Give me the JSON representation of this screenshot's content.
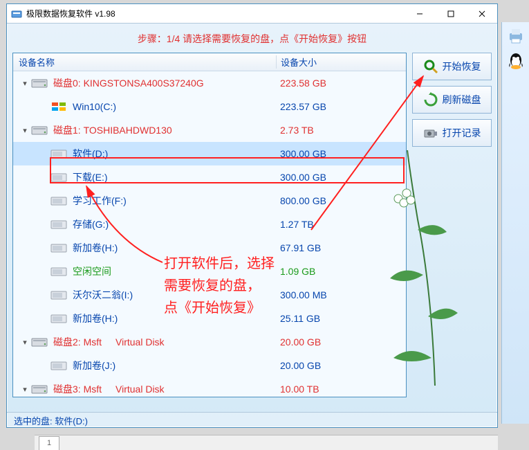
{
  "window_title": "极限数据恢复软件 v1.98",
  "step_banner": "步骤：1/4 请选择需要恢复的盘，点《开始恢复》按钮",
  "columns": {
    "name": "设备名称",
    "size": "设备大小"
  },
  "rows": [
    {
      "exp": "▾",
      "indent": 0,
      "label": "磁盘0: KINGSTONSA400S37240G",
      "size": "223.58 GB",
      "color": "red",
      "icon": "hdd"
    },
    {
      "exp": "",
      "indent": 1,
      "label": "Win10(C:)",
      "size": "223.57 GB",
      "color": "blue",
      "icon": "winvol"
    },
    {
      "exp": "▾",
      "indent": 0,
      "label": "磁盘1: TOSHIBAHDWD130",
      "size": "2.73 TB",
      "color": "red",
      "icon": "hdd"
    },
    {
      "exp": "",
      "indent": 1,
      "label": "软件(D:)",
      "size": "300.00 GB",
      "color": "blue",
      "icon": "vol",
      "selected": true
    },
    {
      "exp": "",
      "indent": 1,
      "label": "下载(E:)",
      "size": "300.00 GB",
      "color": "blue",
      "icon": "vol"
    },
    {
      "exp": "",
      "indent": 1,
      "label": "学习工作(F:)",
      "size": "800.00 GB",
      "color": "blue",
      "icon": "vol"
    },
    {
      "exp": "",
      "indent": 1,
      "label": "存储(G:)",
      "size": "1.27 TB",
      "color": "blue",
      "icon": "vol"
    },
    {
      "exp": "",
      "indent": 1,
      "label": "新加卷(H:)",
      "size": "67.91 GB",
      "color": "blue",
      "icon": "vol"
    },
    {
      "exp": "",
      "indent": 1,
      "label": "空闲空间",
      "size": "1.09 GB",
      "color": "green",
      "icon": "vol"
    },
    {
      "exp": "",
      "indent": 1,
      "label": "沃尔沃二翁(I:)",
      "size": "300.00 MB",
      "color": "blue",
      "icon": "vol"
    },
    {
      "exp": "",
      "indent": 1,
      "label": "新加卷(H:)",
      "size": "25.11 GB",
      "color": "blue",
      "icon": "vol"
    },
    {
      "exp": "▾",
      "indent": 0,
      "label_a": "磁盘2: Msft",
      "label_b": "Virtual Disk",
      "size": "20.00 GB",
      "color": "red",
      "icon": "hdd",
      "split": true
    },
    {
      "exp": "",
      "indent": 1,
      "label": "新加卷(J:)",
      "size": "20.00 GB",
      "color": "blue",
      "icon": "vol"
    },
    {
      "exp": "▾",
      "indent": 0,
      "label_a": "磁盘3: Msft",
      "label_b": "Virtual Disk",
      "size": "10.00 TB",
      "color": "red",
      "icon": "hdd",
      "split": true
    }
  ],
  "buttons": {
    "start_recovery": "开始恢复",
    "refresh_disks": "刷新磁盘",
    "open_records": "打开记录"
  },
  "annotation": {
    "line1": "打开软件后，选择",
    "line2": "需要恢复的盘，",
    "line3": "点《开始恢复》"
  },
  "status_prefix": "选中的盘: ",
  "status_value": "软件(D:)",
  "bottom_tab": "1"
}
